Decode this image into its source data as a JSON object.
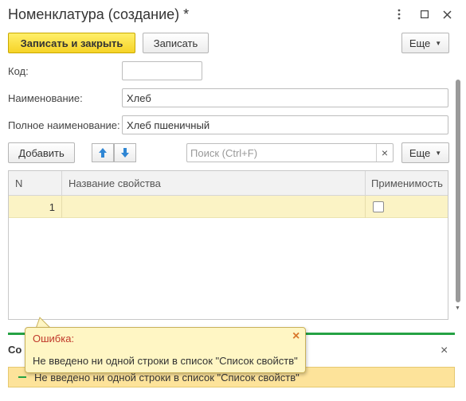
{
  "window": {
    "title": "Номенклатура (создание) *"
  },
  "toolbar": {
    "save_close_label": "Записать и закрыть",
    "save_label": "Записать",
    "more_label": "Еще"
  },
  "form": {
    "code_label": "Код:",
    "code_value": "",
    "name_label": "Наименование:",
    "name_value": "Хлеб",
    "fullname_label": "Полное наименование:",
    "fullname_value": "Хлеб пшеничный"
  },
  "table_toolbar": {
    "add_label": "Добавить",
    "search_placeholder": "Поиск (Ctrl+F)",
    "clear_glyph": "×",
    "more_label": "Еще"
  },
  "table": {
    "columns": [
      "N",
      "Название свойства",
      "Применимость"
    ],
    "rows": [
      {
        "n": "1",
        "name": "",
        "applicable": false
      }
    ]
  },
  "bottom_panel": {
    "title_partial": "Со",
    "close_glyph": "×",
    "message": "Не введено ни одной строки в список \"Список свойств\""
  },
  "tooltip": {
    "title": "Ошибка:",
    "message": "Не введено ни одной строки в список \"Список свойств\"",
    "close_glyph": "×"
  },
  "colors": {
    "primary_button": "#f6d327",
    "selected_row": "#fbf3c5",
    "accent_green": "#25a244",
    "error_title": "#c0392b",
    "arrow_blue": "#2f86d4"
  }
}
